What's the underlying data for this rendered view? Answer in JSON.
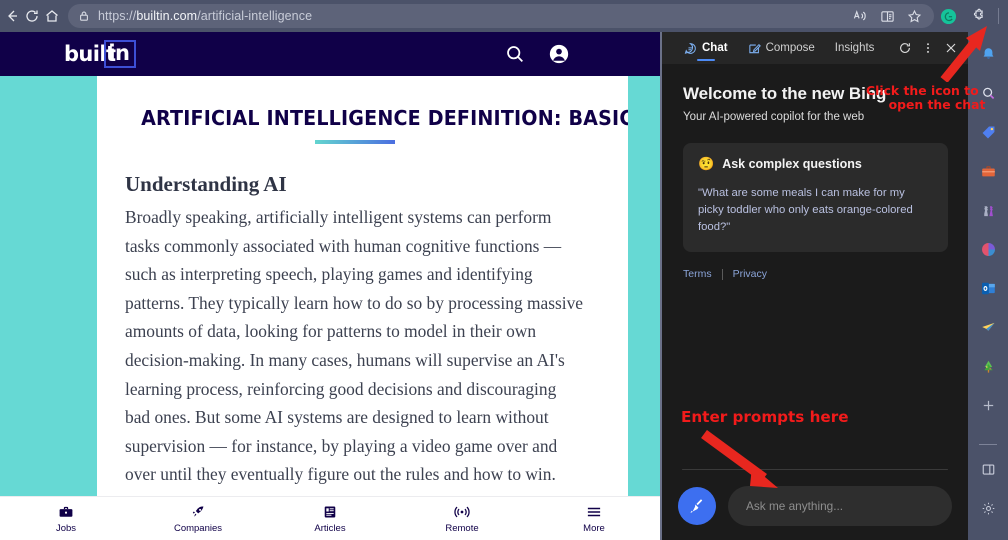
{
  "browser": {
    "url_prefix": "https://",
    "url_domain": "builtin.com",
    "url_path": "/artificial-intelligence",
    "back_icon": "back-arrow-icon",
    "refresh_icon": "refresh-icon",
    "home_icon": "home-icon",
    "lock_icon": "lock-icon",
    "read_aloud_icon": "read-aloud-icon",
    "reading_view_icon": "immersive-reader-icon",
    "favorite_icon": "star-icon",
    "toolbar_icons": [
      "grammarly-icon",
      "extensions-puzzle-icon",
      "split-screen-icon",
      "favorites-icon",
      "collections-icon",
      "browser-essentials-icon",
      "profile-avatar-icon",
      "settings-more-icon",
      "bing-chat-icon"
    ]
  },
  "site": {
    "logo_primary": "built",
    "logo_boxed": "in",
    "search_icon": "search-icon",
    "account_icon": "account-icon",
    "article": {
      "title": "ARTIFICIAL INTELLIGENCE DEFINITION: BASICS OF AI",
      "subheading": "Understanding AI",
      "paragraph": "Broadly speaking, artificially intelligent systems can perform tasks commonly associated with human cognitive functions — such as interpreting speech, playing games and identifying patterns. They typically learn how to do so by processing massive amounts of data, looking for patterns to model in their own decision-making. In many cases, humans will supervise an AI's learning process, reinforcing good decisions and discouraging bad ones. But some AI systems are designed to learn without supervision — for instance, by playing a video game over and over until they eventually figure out the rules and how to win."
    },
    "bottom_nav": [
      {
        "label": "Jobs",
        "icon": "briefcase-icon"
      },
      {
        "label": "Companies",
        "icon": "rocket-icon"
      },
      {
        "label": "Articles",
        "icon": "book-icon"
      },
      {
        "label": "Remote",
        "icon": "broadcast-icon"
      },
      {
        "label": "More",
        "icon": "hamburger-menu-icon"
      }
    ]
  },
  "bing_panel": {
    "tabs": [
      {
        "label": "Chat",
        "icon": "chat-bubble-icon",
        "active": true
      },
      {
        "label": "Compose",
        "icon": "compose-pencil-icon",
        "active": false
      },
      {
        "label": "Insights",
        "icon": "",
        "active": false
      }
    ],
    "actions": [
      "refresh-icon",
      "more-options-icon",
      "close-icon"
    ],
    "welcome_title": "Welcome to the new Bing",
    "tagline": "Your AI-powered copilot for the web",
    "card": {
      "emoji": "🤨",
      "title": "Ask complex questions",
      "quote": "\"What are some meals I can make for my picky toddler who only eats orange-colored food?\""
    },
    "legal": [
      {
        "label": "Terms"
      },
      {
        "label": "Privacy"
      }
    ],
    "composer": {
      "mic_icon": "sweep-broom-icon",
      "placeholder": "Ask me anything..."
    }
  },
  "edge_sidebar": {
    "icons": [
      "notification-bell-icon",
      "search-icon",
      "shopping-tag-icon",
      "tools-briefcase-icon",
      "games-icon",
      "office-icon",
      "outlook-icon",
      "send-plane-icon",
      "tree-icon",
      "add-icon"
    ],
    "bottom_icons": [
      "split-pane-icon",
      "settings-gear-icon"
    ]
  },
  "annotations": {
    "top": {
      "line1": "Click the icon to",
      "line2": "open the chat",
      "color": "#f21b1b"
    },
    "bottom": {
      "text": "Enter prompts here",
      "color": "#f21b1b"
    }
  }
}
